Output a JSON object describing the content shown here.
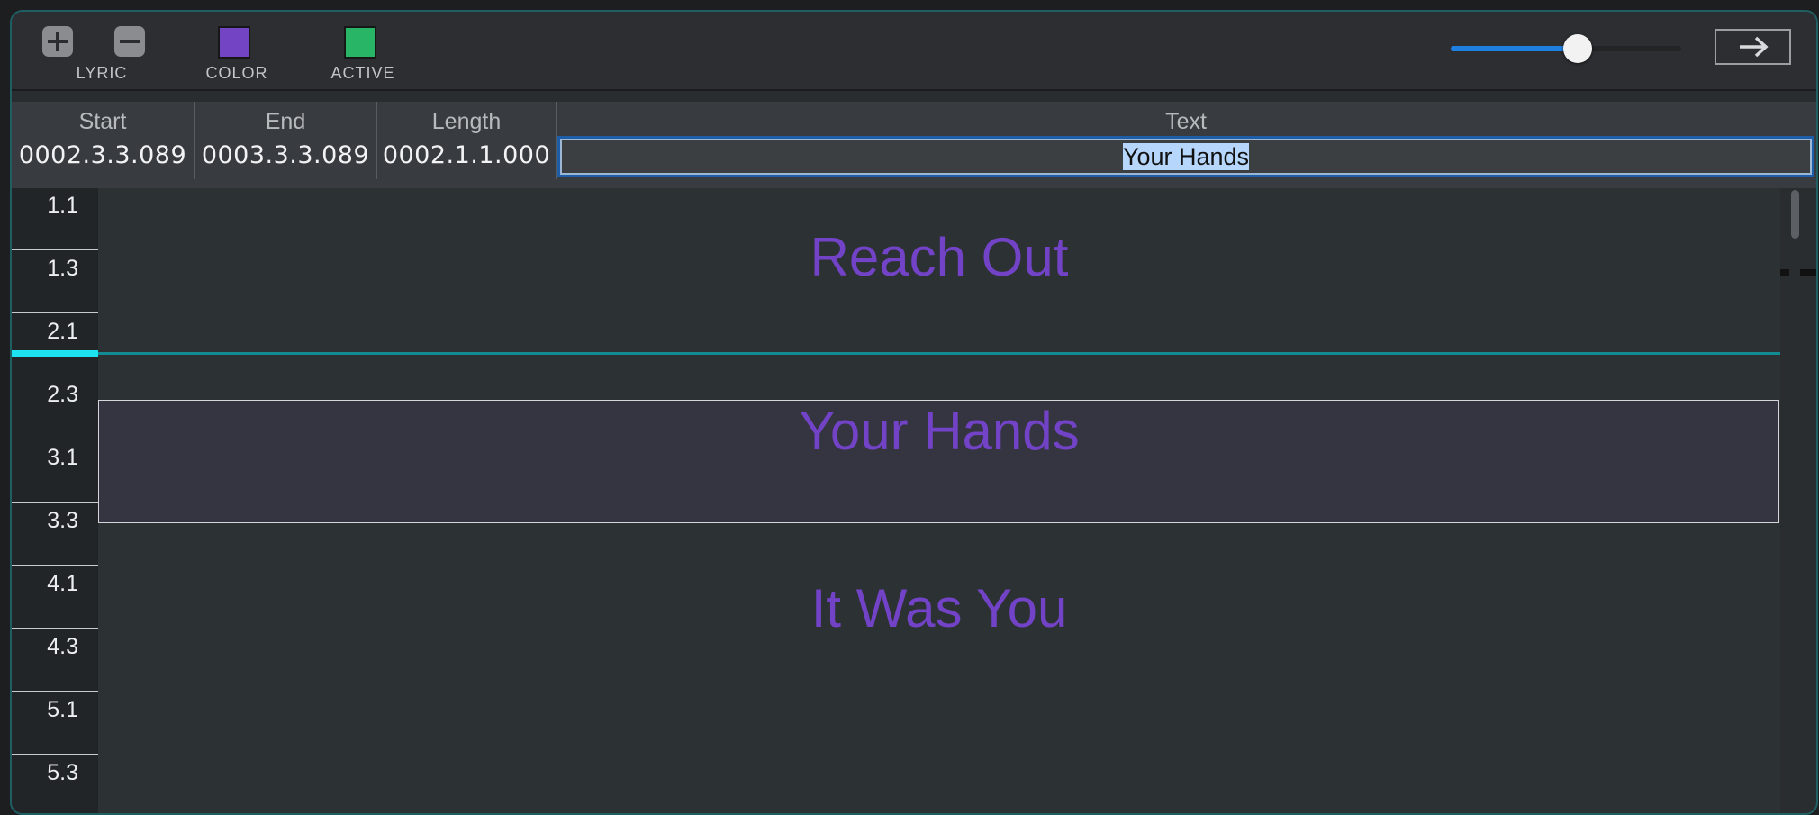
{
  "toolbar": {
    "lyric_label": "LYRIC",
    "color_label": "COLOR",
    "active_label": "ACTIVE",
    "color_value": "#7345c4",
    "active_value": "#28b566",
    "zoom_fraction": 0.55,
    "icons": [
      "plus-icon",
      "minus-icon",
      "arrow-right-icon"
    ]
  },
  "header": {
    "columns": [
      {
        "name": "Start",
        "value": "0002.3.3.089"
      },
      {
        "name": "End",
        "value": "0003.3.3.089"
      },
      {
        "name": "Length",
        "value": "0002.1.1.000"
      },
      {
        "name": "Text",
        "value": "Your Hands"
      }
    ]
  },
  "ruler": {
    "labels": [
      "1.1",
      "1.3",
      "2.1",
      "2.3",
      "3.1",
      "3.3",
      "4.1",
      "4.3",
      "5.1",
      "5.3"
    ]
  },
  "lyrics": [
    {
      "text": "Reach Out"
    },
    {
      "text": "Your Hands",
      "selected": true
    },
    {
      "text": "It Was You"
    }
  ],
  "colors": {
    "accent": "#1f7fe0",
    "lyric_text": "#7243c6",
    "playhead": "#1de3f0"
  }
}
